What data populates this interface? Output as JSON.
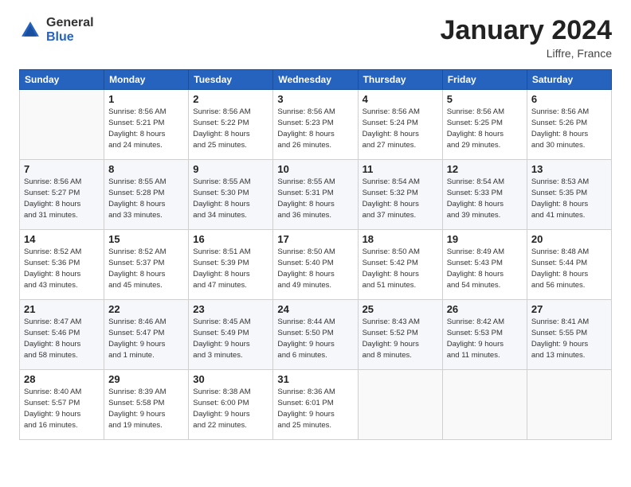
{
  "logo": {
    "general": "General",
    "blue": "Blue"
  },
  "header": {
    "title": "January 2024",
    "location": "Liffre, France"
  },
  "days_of_week": [
    "Sunday",
    "Monday",
    "Tuesday",
    "Wednesday",
    "Thursday",
    "Friday",
    "Saturday"
  ],
  "weeks": [
    [
      {
        "day": "",
        "info": ""
      },
      {
        "day": "1",
        "info": "Sunrise: 8:56 AM\nSunset: 5:21 PM\nDaylight: 8 hours\nand 24 minutes."
      },
      {
        "day": "2",
        "info": "Sunrise: 8:56 AM\nSunset: 5:22 PM\nDaylight: 8 hours\nand 25 minutes."
      },
      {
        "day": "3",
        "info": "Sunrise: 8:56 AM\nSunset: 5:23 PM\nDaylight: 8 hours\nand 26 minutes."
      },
      {
        "day": "4",
        "info": "Sunrise: 8:56 AM\nSunset: 5:24 PM\nDaylight: 8 hours\nand 27 minutes."
      },
      {
        "day": "5",
        "info": "Sunrise: 8:56 AM\nSunset: 5:25 PM\nDaylight: 8 hours\nand 29 minutes."
      },
      {
        "day": "6",
        "info": "Sunrise: 8:56 AM\nSunset: 5:26 PM\nDaylight: 8 hours\nand 30 minutes."
      }
    ],
    [
      {
        "day": "7",
        "info": "Sunrise: 8:56 AM\nSunset: 5:27 PM\nDaylight: 8 hours\nand 31 minutes."
      },
      {
        "day": "8",
        "info": "Sunrise: 8:55 AM\nSunset: 5:28 PM\nDaylight: 8 hours\nand 33 minutes."
      },
      {
        "day": "9",
        "info": "Sunrise: 8:55 AM\nSunset: 5:30 PM\nDaylight: 8 hours\nand 34 minutes."
      },
      {
        "day": "10",
        "info": "Sunrise: 8:55 AM\nSunset: 5:31 PM\nDaylight: 8 hours\nand 36 minutes."
      },
      {
        "day": "11",
        "info": "Sunrise: 8:54 AM\nSunset: 5:32 PM\nDaylight: 8 hours\nand 37 minutes."
      },
      {
        "day": "12",
        "info": "Sunrise: 8:54 AM\nSunset: 5:33 PM\nDaylight: 8 hours\nand 39 minutes."
      },
      {
        "day": "13",
        "info": "Sunrise: 8:53 AM\nSunset: 5:35 PM\nDaylight: 8 hours\nand 41 minutes."
      }
    ],
    [
      {
        "day": "14",
        "info": "Sunrise: 8:52 AM\nSunset: 5:36 PM\nDaylight: 8 hours\nand 43 minutes."
      },
      {
        "day": "15",
        "info": "Sunrise: 8:52 AM\nSunset: 5:37 PM\nDaylight: 8 hours\nand 45 minutes."
      },
      {
        "day": "16",
        "info": "Sunrise: 8:51 AM\nSunset: 5:39 PM\nDaylight: 8 hours\nand 47 minutes."
      },
      {
        "day": "17",
        "info": "Sunrise: 8:50 AM\nSunset: 5:40 PM\nDaylight: 8 hours\nand 49 minutes."
      },
      {
        "day": "18",
        "info": "Sunrise: 8:50 AM\nSunset: 5:42 PM\nDaylight: 8 hours\nand 51 minutes."
      },
      {
        "day": "19",
        "info": "Sunrise: 8:49 AM\nSunset: 5:43 PM\nDaylight: 8 hours\nand 54 minutes."
      },
      {
        "day": "20",
        "info": "Sunrise: 8:48 AM\nSunset: 5:44 PM\nDaylight: 8 hours\nand 56 minutes."
      }
    ],
    [
      {
        "day": "21",
        "info": "Sunrise: 8:47 AM\nSunset: 5:46 PM\nDaylight: 8 hours\nand 58 minutes."
      },
      {
        "day": "22",
        "info": "Sunrise: 8:46 AM\nSunset: 5:47 PM\nDaylight: 9 hours\nand 1 minute."
      },
      {
        "day": "23",
        "info": "Sunrise: 8:45 AM\nSunset: 5:49 PM\nDaylight: 9 hours\nand 3 minutes."
      },
      {
        "day": "24",
        "info": "Sunrise: 8:44 AM\nSunset: 5:50 PM\nDaylight: 9 hours\nand 6 minutes."
      },
      {
        "day": "25",
        "info": "Sunrise: 8:43 AM\nSunset: 5:52 PM\nDaylight: 9 hours\nand 8 minutes."
      },
      {
        "day": "26",
        "info": "Sunrise: 8:42 AM\nSunset: 5:53 PM\nDaylight: 9 hours\nand 11 minutes."
      },
      {
        "day": "27",
        "info": "Sunrise: 8:41 AM\nSunset: 5:55 PM\nDaylight: 9 hours\nand 13 minutes."
      }
    ],
    [
      {
        "day": "28",
        "info": "Sunrise: 8:40 AM\nSunset: 5:57 PM\nDaylight: 9 hours\nand 16 minutes."
      },
      {
        "day": "29",
        "info": "Sunrise: 8:39 AM\nSunset: 5:58 PM\nDaylight: 9 hours\nand 19 minutes."
      },
      {
        "day": "30",
        "info": "Sunrise: 8:38 AM\nSunset: 6:00 PM\nDaylight: 9 hours\nand 22 minutes."
      },
      {
        "day": "31",
        "info": "Sunrise: 8:36 AM\nSunset: 6:01 PM\nDaylight: 9 hours\nand 25 minutes."
      },
      {
        "day": "",
        "info": ""
      },
      {
        "day": "",
        "info": ""
      },
      {
        "day": "",
        "info": ""
      }
    ]
  ]
}
